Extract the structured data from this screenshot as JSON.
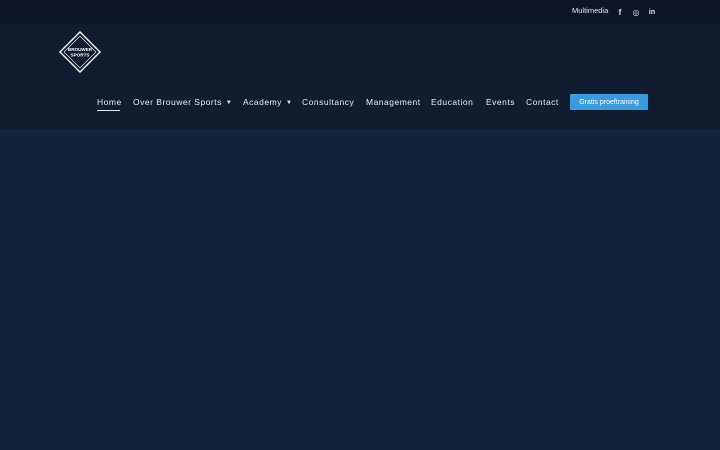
{
  "topbar": {
    "multimedia_label": "Multimedia",
    "social": [
      {
        "icon": "facebook-icon",
        "glyph": "f"
      },
      {
        "icon": "instagram-icon",
        "glyph": "◎"
      },
      {
        "icon": "linkedin-icon",
        "glyph": "in"
      }
    ]
  },
  "logo": {
    "line1": "BROUWER",
    "line2": "SPORTS"
  },
  "nav": {
    "home": "Home",
    "over": "Over Brouwer Sports",
    "academy": "Academy",
    "consultancy": "Consultancy",
    "management": "Management",
    "education": "Education",
    "events": "Events",
    "contact": "Contact",
    "cta": "Gratis proeftraining"
  },
  "colors": {
    "topbar": "#0d1526",
    "header": "#121c30",
    "hero": "#16223a",
    "accent": "#3a9bdc"
  }
}
